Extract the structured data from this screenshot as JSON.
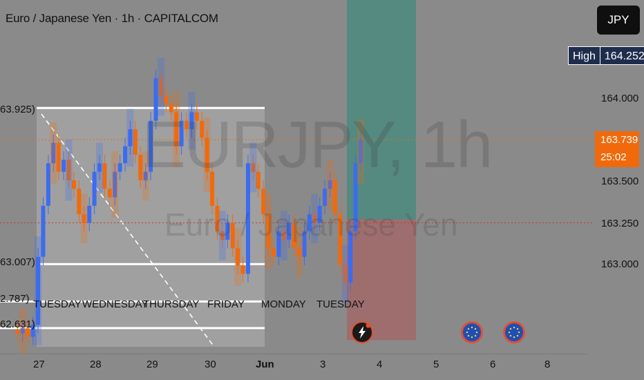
{
  "header": {
    "title": "Euro / Japanese Yen · 1h · CAPITALCOM"
  },
  "currency_button": {
    "label": "JPY"
  },
  "high": {
    "label": "High",
    "value": "164.252"
  },
  "current_price": {
    "value": "163.739",
    "countdown": "25:02"
  },
  "watermark": {
    "symbol": "EURJPY, 1h",
    "name": "Euro / Japanese Yen"
  },
  "price_axis": [
    {
      "label": "164.000",
      "value": 164.0
    },
    {
      "label": "163.500",
      "value": 163.5
    },
    {
      "label": "163.250",
      "value": 163.25
    },
    {
      "label": "163.000",
      "value": 163.0
    }
  ],
  "date_axis": [
    "27",
    "28",
    "29",
    "30",
    "Jun",
    "3",
    "4",
    "5",
    "6",
    "8"
  ],
  "left_levels": [
    {
      "label": "63.925)",
      "value": 163.925
    },
    {
      "label": "63.007)",
      "value": 163.007
    },
    {
      "label": "2.787)",
      "value": 162.787
    },
    {
      "label": "62.631)",
      "value": 162.631
    }
  ],
  "day_labels": [
    "TUESDAY",
    "WEDNESDAY",
    "THURSDAY",
    "FRIDAY",
    "MONDAY",
    "TUESDAY"
  ],
  "colors": {
    "bull": "#3b6cf0",
    "bear": "#f06a0c",
    "target": "#4f8a7e",
    "stop": "#a06a6a",
    "current": "#f06a0c"
  },
  "chart_data": {
    "type": "candlestick",
    "title": "Euro / Japanese Yen · 1h · CAPITALCOM",
    "ylim": [
      162.48,
      164.56
    ],
    "levels": [
      163.925,
      163.007,
      162.787,
      162.631
    ],
    "current": 163.739,
    "high": 164.252,
    "dotted_level": 163.25,
    "long_position": {
      "entry": 163.27,
      "target": 164.56,
      "stop": 162.56
    },
    "series": [
      {
        "name": "close path",
        "values": [
          162.62,
          162.6,
          162.63,
          162.58,
          162.65,
          163.05,
          163.35,
          163.6,
          163.72,
          163.55,
          163.62,
          163.5,
          163.45,
          163.3,
          163.25,
          163.35,
          163.55,
          163.6,
          163.45,
          163.4,
          163.55,
          163.6,
          163.7,
          163.8,
          163.65,
          163.5,
          163.55,
          163.85,
          164.1,
          164.0,
          163.95,
          163.9,
          163.7,
          163.85,
          163.8,
          163.9,
          163.85,
          163.75,
          163.55,
          163.35,
          163.2,
          163.15,
          163.25,
          163.1,
          163.0,
          162.95,
          163.6,
          163.55,
          163.45,
          163.3,
          163.1,
          163.05,
          163.2,
          163.15,
          163.25,
          163.1,
          163.05,
          163.2,
          163.3,
          163.25,
          163.35,
          163.45,
          163.5,
          163.3,
          163.0,
          162.9,
          163.2,
          163.6,
          163.74
        ]
      }
    ]
  }
}
